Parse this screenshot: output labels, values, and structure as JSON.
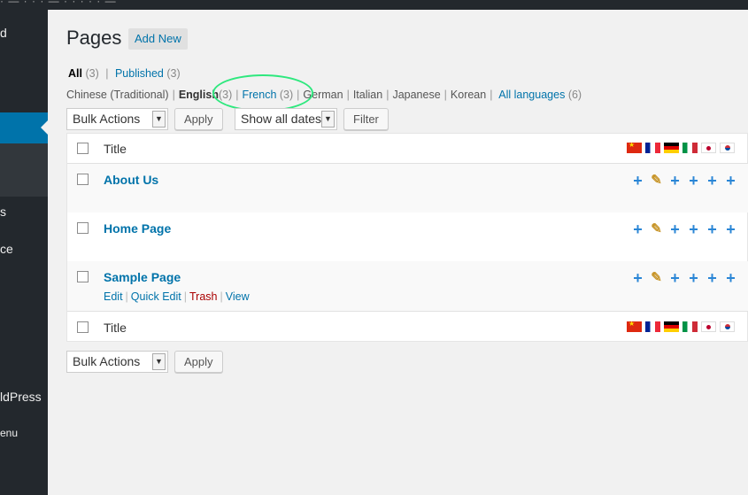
{
  "adminbar": {
    "text": "· — · · · — · · · · · —"
  },
  "sidebar": {
    "items": [
      {
        "label": "d"
      },
      {
        "label": "s"
      },
      {
        "label": "ce"
      },
      {
        "label": "ldPress"
      },
      {
        "label": "enu"
      }
    ]
  },
  "page": {
    "title": "Pages",
    "add_new": "Add New"
  },
  "views": {
    "all_label": "All",
    "all_count": "(3)",
    "published_label": "Published",
    "published_count": "(3)"
  },
  "languages": {
    "items": [
      {
        "label": "Chinese (Traditional)",
        "count": ""
      },
      {
        "label": "English",
        "count": "(3)"
      },
      {
        "label": "French",
        "count": "(3)"
      },
      {
        "label": "German",
        "count": ""
      },
      {
        "label": "Italian",
        "count": ""
      },
      {
        "label": "Japanese",
        "count": ""
      },
      {
        "label": "Korean",
        "count": ""
      }
    ],
    "all_languages": "All languages",
    "all_languages_count": "(6)"
  },
  "toolbar": {
    "bulk_actions": "Bulk Actions",
    "apply": "Apply",
    "dates": "Show all dates",
    "filter": "Filter"
  },
  "table": {
    "column_title": "Title",
    "flags": [
      "flag-china-icon",
      "flag-france-icon",
      "flag-germany-icon",
      "flag-italy-icon",
      "flag-japan-icon",
      "flag-korea-icon"
    ],
    "rows": [
      {
        "title": "About Us"
      },
      {
        "title": "Home Page"
      },
      {
        "title": "Sample Page",
        "actions": {
          "edit": "Edit",
          "quick_edit": "Quick Edit",
          "trash": "Trash",
          "view": "View"
        }
      }
    ]
  },
  "colors": {
    "accent": "#0073aa",
    "highlight": "#2ee87e",
    "sidebar": "#23282d",
    "trash": "#a00000"
  }
}
